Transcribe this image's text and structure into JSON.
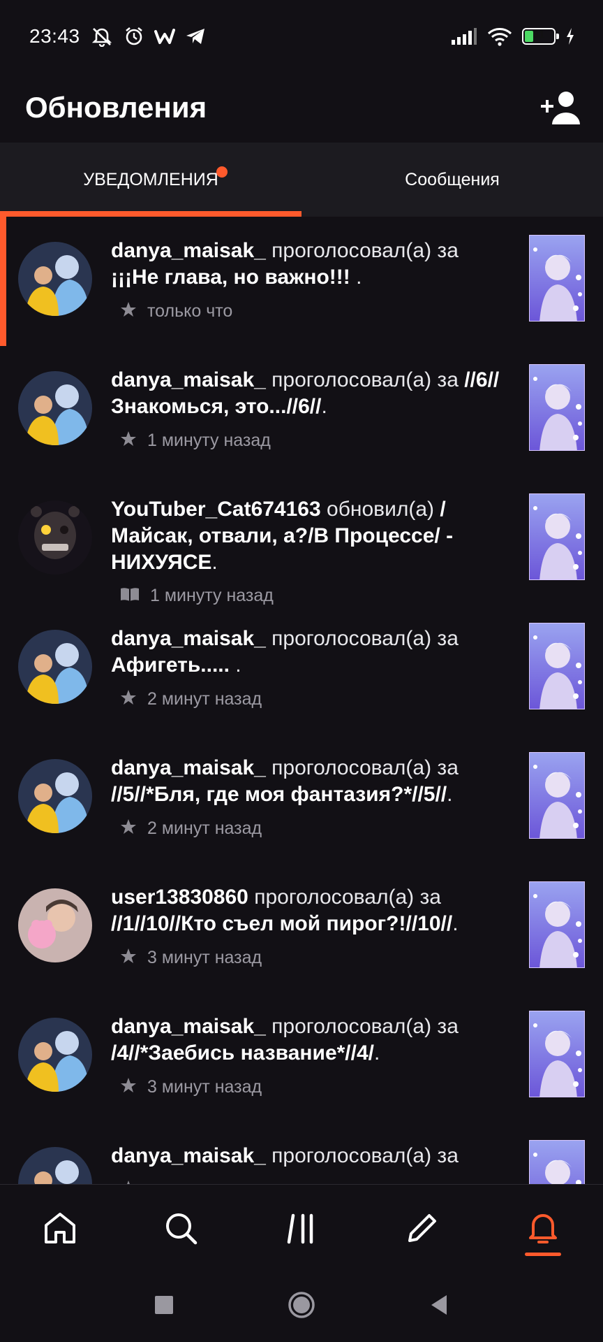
{
  "status_bar": {
    "time": "23:43",
    "battery_level": "31",
    "icons_left": [
      "mute-notifications-icon",
      "alarm-icon",
      "wattpad-icon",
      "telegram-icon"
    ],
    "icons_right": [
      "signal-icon",
      "wifi-icon",
      "battery-icon",
      "charging-icon"
    ]
  },
  "header": {
    "title": "Обновления",
    "add_user_icon": "add-user-icon"
  },
  "tabs": [
    {
      "label": "УВЕДОМЛЕНИЯ",
      "active": true,
      "has_dot": true
    },
    {
      "label": "Сообщения",
      "active": false,
      "has_dot": false
    }
  ],
  "notifications": [
    {
      "user": "danya_maisak_",
      "action": "проголосовал(а) за",
      "story": "¡¡¡Не глава, но важно!!!",
      "tail": " .",
      "icon": "star-icon",
      "time": "только что",
      "unread": true
    },
    {
      "user": "danya_maisak_",
      "action": "проголосовал(а) за",
      "story": "//6//Знакомься, это...//6//",
      "tail": ".",
      "icon": "star-icon",
      "time": "1 минуту назад",
      "unread": false
    },
    {
      "user": "YouTuber_Cat674163",
      "action": "обновил(а)",
      "story": "/Майсак, отвали, а?/В Процессе/ - НИХУЯСЕ",
      "tail": ".",
      "icon": "book-icon",
      "time": "1 минуту назад",
      "unread": false
    },
    {
      "user": "danya_maisak_",
      "action": "проголосовал(а) за",
      "story": "Афигеть.....",
      "tail": " .",
      "icon": "star-icon",
      "time": "2 минут назад",
      "unread": false
    },
    {
      "user": "danya_maisak_",
      "action": "проголосовал(а) за",
      "story": "//5//*Бля, где моя фантазия?*//5//",
      "tail": ".",
      "icon": "star-icon",
      "time": "2 минут назад",
      "unread": false
    },
    {
      "user": "user13830860",
      "action": "проголосовал(а) за",
      "story": "//1//10//Кто съел мой пирог?!//10//",
      "tail": ".",
      "icon": "star-icon",
      "time": "3 минут назад",
      "unread": false
    },
    {
      "user": "danya_maisak_",
      "action": "проголосовал(а) за",
      "story": "/4//*Заебись название*//4/",
      "tail": ".",
      "icon": "star-icon",
      "time": "3 минут назад",
      "unread": false
    },
    {
      "user": "danya_maisak_",
      "action": "проголосовал(а) за",
      "story": "",
      "tail": "",
      "icon": "star-icon",
      "time": "",
      "unread": false
    }
  ],
  "bottom_nav": [
    {
      "name": "home-icon",
      "active": false
    },
    {
      "name": "search-icon",
      "active": false
    },
    {
      "name": "library-icon",
      "active": false
    },
    {
      "name": "write-icon",
      "active": false
    },
    {
      "name": "bell-icon",
      "active": true
    }
  ],
  "system_nav": [
    "recents-button",
    "home-button",
    "back-button"
  ],
  "colors": {
    "accent": "#ff5a2c",
    "background": "#121015",
    "tab_bar": "#1c1b20",
    "muted_text": "#9c9aa3"
  }
}
